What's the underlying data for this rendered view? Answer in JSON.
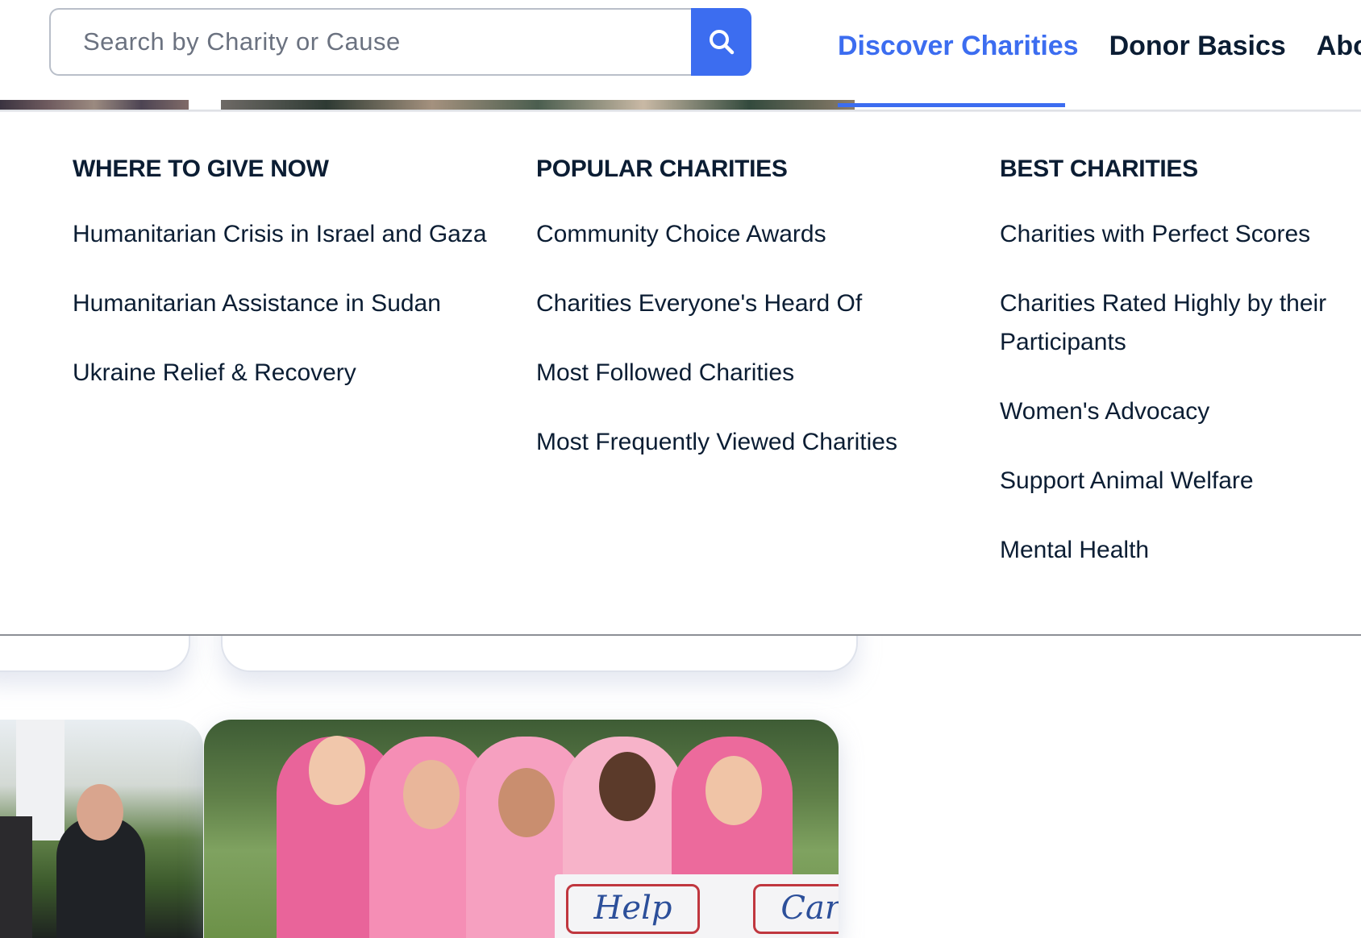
{
  "search": {
    "placeholder": "Search by Charity or Cause",
    "button_icon": "search-icon"
  },
  "nav": {
    "items": [
      {
        "label": "Discover Charities",
        "active": true
      },
      {
        "label": "Donor Basics",
        "active": false
      },
      {
        "label": "About",
        "active": false
      }
    ]
  },
  "menu": {
    "where_to_give": {
      "heading": "WHERE TO GIVE NOW",
      "items": [
        "Humanitarian Crisis in Israel and Gaza",
        "Humanitarian Assistance in Sudan",
        "Ukraine Relief & Recovery"
      ]
    },
    "popular": {
      "heading": "POPULAR CHARITIES",
      "items": [
        "Community Choice Awards",
        "Charities Everyone's Heard Of",
        "Most Followed Charities",
        "Most Frequently Viewed Charities"
      ]
    },
    "best": {
      "heading": "BEST CHARITIES",
      "items": [
        "Charities with Perfect Scores",
        "Charities Rated Highly by their Participants",
        "Women's Advocacy",
        "Support Animal Welfare",
        "Mental Health"
      ]
    }
  },
  "photo_sign": {
    "word_1": "Help",
    "word_2": "Care"
  },
  "colors": {
    "accent": "#3c6df0",
    "text_dark": "#0b1d33"
  }
}
